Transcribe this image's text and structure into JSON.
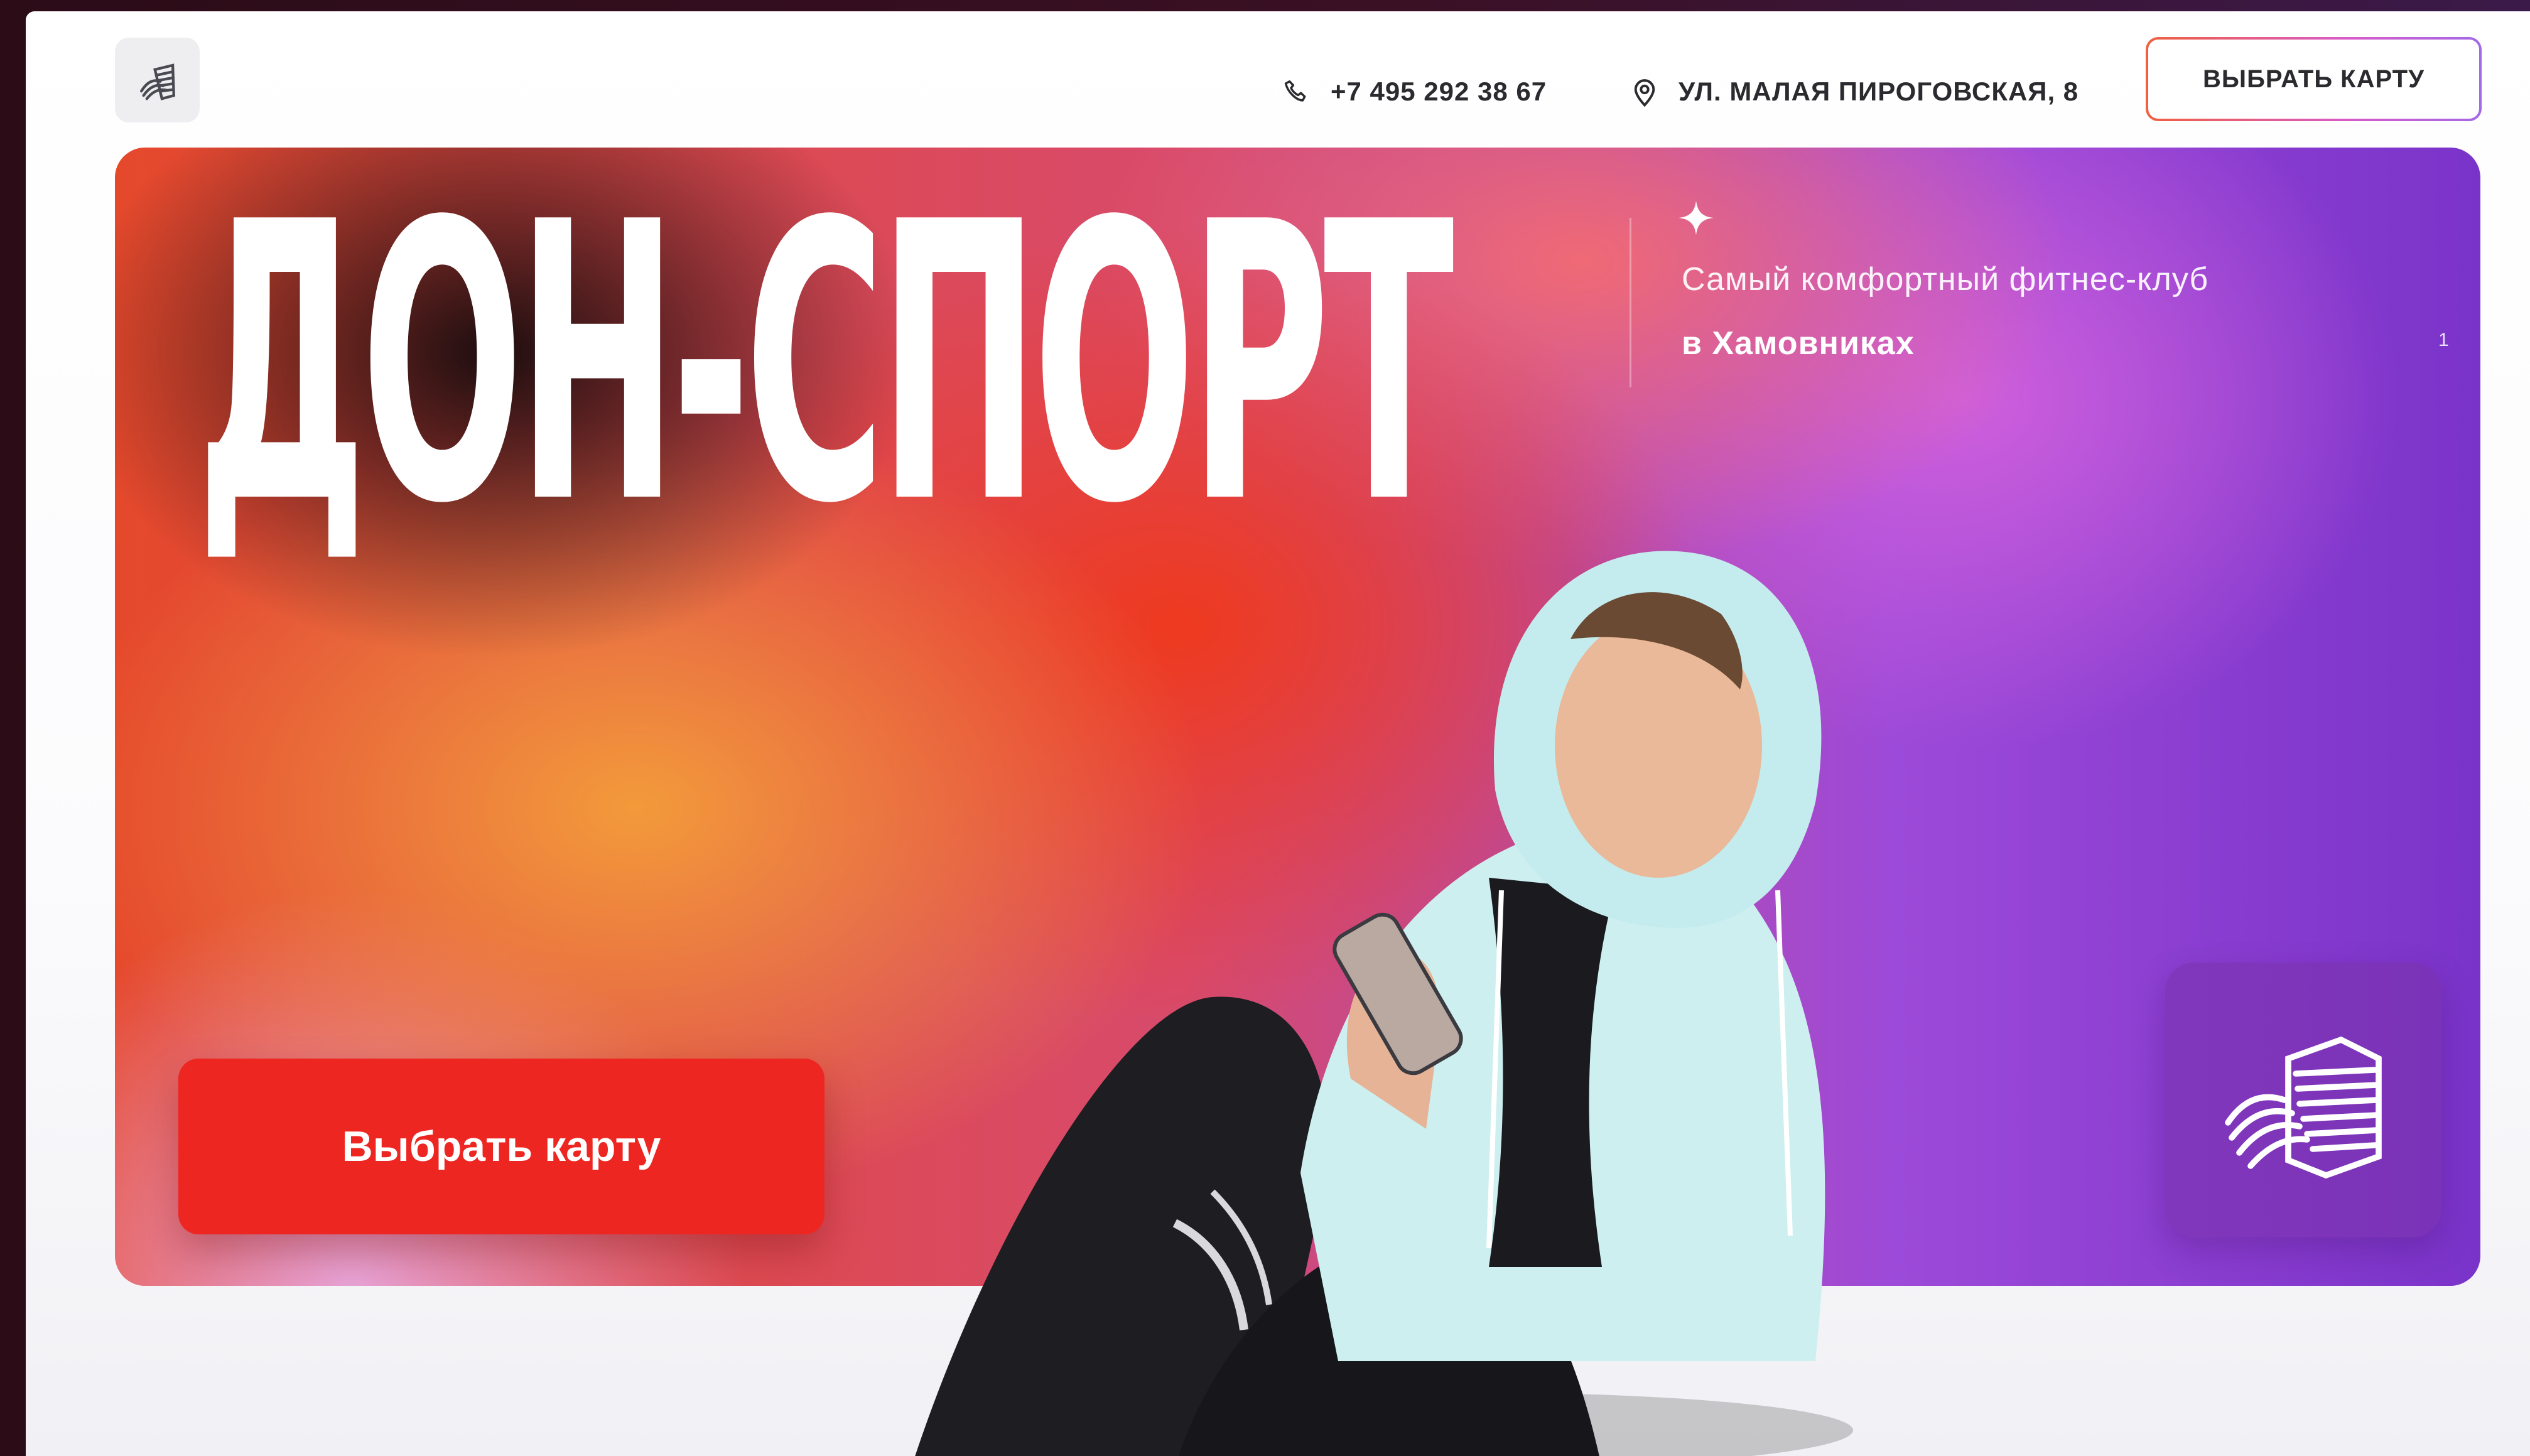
{
  "header": {
    "phone": "+7 495 292 38 67",
    "address": "УЛ. МАЛАЯ ПИРОГОВСКАЯ, 8",
    "cta_label": "ВЫБРАТЬ КАРТУ",
    "logo_icon": "don-sport-logo-icon",
    "phone_icon": "phone-icon",
    "address_icon": "location-pin-icon"
  },
  "hero": {
    "title": "ДОН-СПОРТ",
    "subtitle_line1": "Самый комфортный фитнес-клуб",
    "subtitle_line2": "в Хамовниках",
    "slide_number": "1",
    "cta_label": "Выбрать карту",
    "sparkle_icon": "sparkle-icon",
    "badge_icon": "don-sport-logo-icon"
  },
  "colors": {
    "cta_red": "#ee2622",
    "text_dark": "#2b2b2f",
    "gradient_orange": "#f39a3a",
    "gradient_red": "#ee3a1f",
    "gradient_purple": "#7a33c9"
  }
}
